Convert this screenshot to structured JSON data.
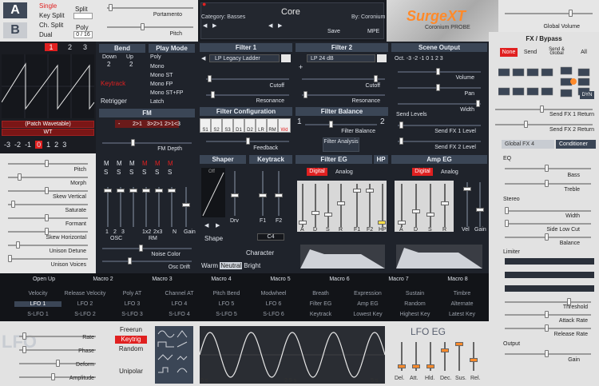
{
  "scene": {
    "a": "A",
    "b": "B",
    "modes": [
      "Single",
      "Key Split",
      "Ch. Split",
      "Dual"
    ],
    "split_label": "Split",
    "poly_label": "Poly",
    "poly_value": "0 / 16"
  },
  "top": {
    "portamento": "Portamento",
    "pitch": "Pitch"
  },
  "patch": {
    "category": "Category: Basses",
    "name": "Core",
    "author": "By: Coronium",
    "save": "Save",
    "mpe": "MPE"
  },
  "logo": {
    "main": "SurgeXT",
    "skin": "Coronium PROBE"
  },
  "global_volume": "Global Volume",
  "fx_bypass": {
    "title": "FX / Bypass",
    "options": [
      "None",
      "Send",
      "Send & Global",
      "All"
    ],
    "dyn": "DYN"
  },
  "osc": {
    "tabs": [
      "1",
      "2",
      "3"
    ],
    "type": "(Patch Wavetable)",
    "wt": "WT",
    "octaves": [
      "-3",
      "-2",
      "-1",
      "0",
      "1",
      "2",
      "3"
    ],
    "params": [
      "Pitch",
      "Morph",
      "Skew Vertical",
      "Saturate",
      "Formant",
      "Skew Horizontal",
      "Unison Detune",
      "Unison Voices"
    ]
  },
  "bend": {
    "title": "Bend",
    "down": "Down",
    "up": "Up",
    "down_val": "2",
    "up_val": "2",
    "keytrack": "Keytrack",
    "retrigger": "Retrigger"
  },
  "play_mode": {
    "title": "Play Mode",
    "items": [
      "Poly",
      "Mono",
      "Mono ST",
      "Mono FP",
      "Mono ST+FP",
      "Latch"
    ]
  },
  "fm": {
    "title": "FM",
    "routes": [
      "-",
      "2>1",
      "3>2>1",
      "2>1<3"
    ],
    "depth": "FM Depth"
  },
  "mixer": {
    "m_labels": [
      "M",
      "M",
      "M",
      "M",
      "M",
      "M"
    ],
    "s_labels": [
      "S",
      "S",
      "S",
      "S",
      "S",
      "S"
    ],
    "bottom": [
      "1",
      "2",
      "3",
      "OSC",
      "1x2",
      "2x3",
      "RM",
      "N",
      "Gain"
    ],
    "noise_color": "Noise Color",
    "osc_drift": "Osc Drift"
  },
  "filter1": {
    "title": "Filter 1",
    "type": "LP Legacy Ladder",
    "cutoff": "Cutoff",
    "resonance": "Resonance"
  },
  "filter2": {
    "title": "Filter 2",
    "type": "LP 24 dB",
    "cutoff": "Cutoff",
    "resonance": "Resonance"
  },
  "filter_config": {
    "title": "Filter Configuration",
    "routes": [
      "S1",
      "S2",
      "S3",
      "D1",
      "D2",
      "LR",
      "RM",
      "Wd"
    ],
    "feedback": "Feedback"
  },
  "filter_balance": {
    "title": "Filter Balance",
    "balance": "Filter Balance",
    "analysis": "Filter Analysis"
  },
  "scene_output": {
    "title": "Scene Output",
    "octaves": "Oct. -3 -2 -1 0 1 2 3",
    "volume": "Volume",
    "pan": "Pan",
    "width": "Width",
    "send_levels": "Send Levels",
    "send1": "Send FX 1 Level",
    "send2": "Send FX 2 Level"
  },
  "shaper": {
    "title": "Shaper",
    "type": "Off",
    "drv": "Drv",
    "shape": "Shape",
    "character": "Character",
    "warm": "Warm",
    "neutral": "Neutral",
    "bright": "Bright"
  },
  "keytrack": {
    "title": "Keytrack",
    "f1": "F1",
    "f2": "F2",
    "root": "C4"
  },
  "filter_eg": {
    "title": "Filter EG",
    "hp": "HP",
    "digital": "Digital",
    "analog": "Analog",
    "labels": [
      "A",
      "D",
      "S",
      "R",
      "F1",
      "F2",
      "HP"
    ]
  },
  "amp_eg": {
    "title": "Amp EG",
    "digital": "Digital",
    "analog": "Analog",
    "labels": [
      "A",
      "D",
      "S",
      "R",
      "Vel",
      "Gain"
    ]
  },
  "fx_right": {
    "return1": "Send FX 1 Return",
    "return2": "Send FX 2 Return",
    "global_fx": "Global FX 4",
    "conditioner": "Conditioner",
    "eq": "EQ",
    "bass": "Bass",
    "treble": "Treble",
    "stereo": "Stereo",
    "width": "Width",
    "side_low_cut": "Side Low Cut",
    "balance": "Balance",
    "limiter": "Limiter",
    "threshold": "Threshold",
    "attack": "Attack Rate",
    "release": "Release Rate",
    "output": "Output",
    "gain": "Gain"
  },
  "macros": {
    "row": [
      "Open Up",
      "Macro 2",
      "Macro 3",
      "Macro 4",
      "Macro 5",
      "Macro 6",
      "Macro 7",
      "Macro 8"
    ]
  },
  "mod_row1": [
    "Velocity",
    "Release Velocity",
    "Poly AT",
    "Channel AT",
    "Pitch Bend",
    "Modwheel",
    "Breath",
    "Expression",
    "Sustain",
    "Timbre"
  ],
  "mod_row2": [
    "LFO 1",
    "LFO 2",
    "LFO 3",
    "LFO 4",
    "LFO 5",
    "LFO 6",
    "Filter EG",
    "Amp EG",
    "Random",
    "Alternate"
  ],
  "mod_row3": [
    "S-LFO 1",
    "S-LFO 2",
    "S-LFO 3",
    "S-LFO 4",
    "S-LFO 5",
    "S-LFO 6",
    "Keytrack",
    "Lowest Key",
    "Highest Key",
    "Latest Key"
  ],
  "lfo": {
    "title": "LFO",
    "rate": "Rate",
    "phase": "Phase",
    "deform": "Deform",
    "amplitude": "Amplitude",
    "freerun": "Freerun",
    "keytrig": "Keytrig",
    "random": "Random",
    "unipolar": "Unipolar",
    "time0": "0 s",
    "time1": "2.5 s",
    "time2": "5 s"
  },
  "lfo_eg": {
    "title": "LFO EG",
    "labels": [
      "Del.",
      "Att.",
      "Hld.",
      "Dec.",
      "Sus.",
      "Rel."
    ]
  },
  "colors": {
    "accent": "#ff8a2a",
    "panel": "#2a303a",
    "header": "#3b4656",
    "light": "#e6e6e6",
    "red": "#e02020"
  }
}
